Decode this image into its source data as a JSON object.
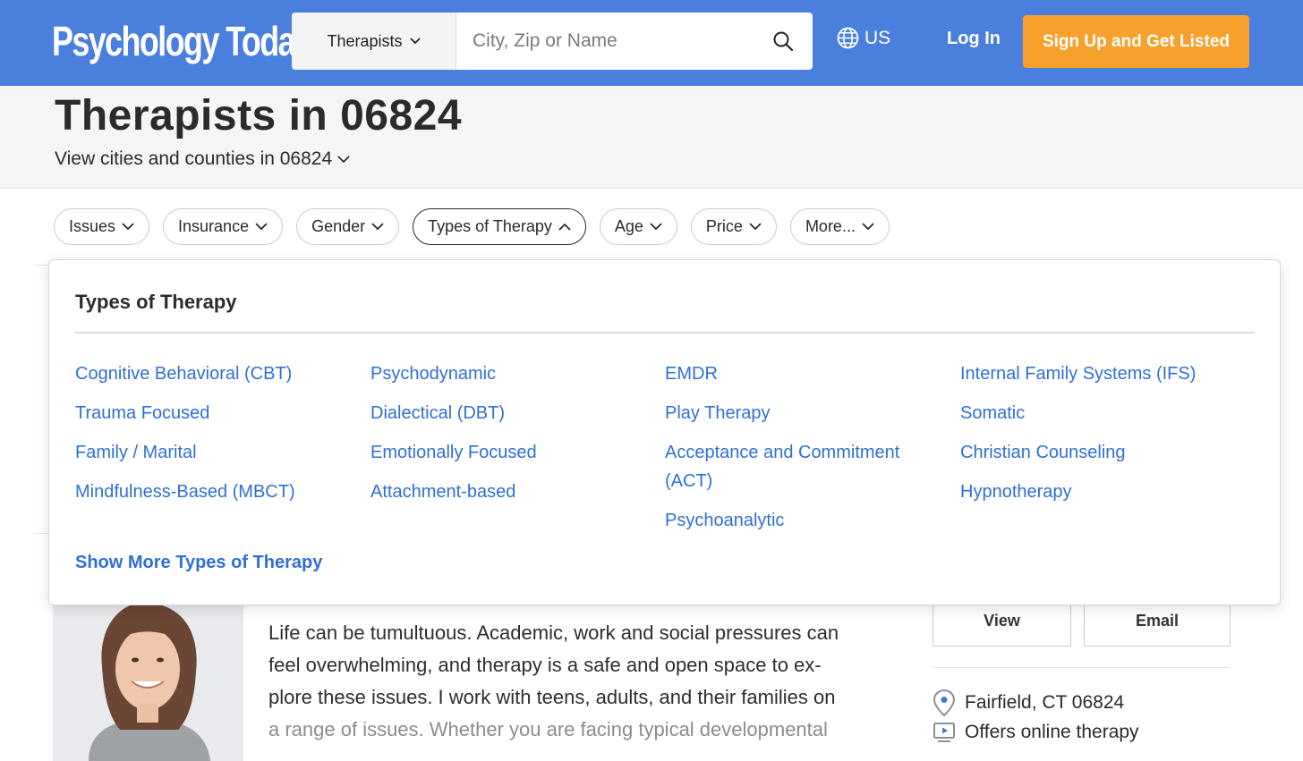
{
  "header": {
    "logo": "Psychology Today",
    "search_type": "Therapists",
    "search_placeholder": "City, Zip or Name",
    "region": "US",
    "login": "Log In",
    "signup": "Sign Up and Get Listed"
  },
  "page": {
    "title": "Therapists in 06824",
    "subtitle": "View cities and counties in 06824"
  },
  "filters": [
    "Issues",
    "Insurance",
    "Gender",
    "Types of Therapy",
    "Age",
    "Price",
    "More..."
  ],
  "dropdown": {
    "title": "Types of Therapy",
    "columns": [
      [
        "Cognitive Behavioral (CBT)",
        "Trauma Focused",
        "Family / Marital",
        "Mindfulness-Based (MBCT)"
      ],
      [
        "Psychodynamic",
        "Dialectical (DBT)",
        "Emotionally Focused",
        "Attachment-based"
      ],
      [
        "EMDR",
        "Play Therapy",
        "Acceptance and Commitment (ACT)",
        "Psychoanalytic"
      ],
      [
        "Internal Family Systems (IFS)",
        "Somatic",
        "Christian Counseling",
        "Hypnotherapy"
      ]
    ],
    "show_more": "Show More Types of Therapy"
  },
  "result": {
    "bio_lines": [
      "Life can be tumultuous. Academic, work and social pressures can",
      "feel overwhelming, and therapy is a safe and open space to ex-",
      "plore these issues. I work with teens, adults, and their families on",
      "a range of issues. Whether you are facing typical developmental"
    ],
    "view_label": "View",
    "email_label": "Email",
    "location": "Fairfield, CT 06824",
    "online": "Offers online therapy"
  },
  "colors": {
    "header_bg": "#4a7fde",
    "signup_bg": "#f7a12c",
    "link": "#2f6fd6"
  }
}
